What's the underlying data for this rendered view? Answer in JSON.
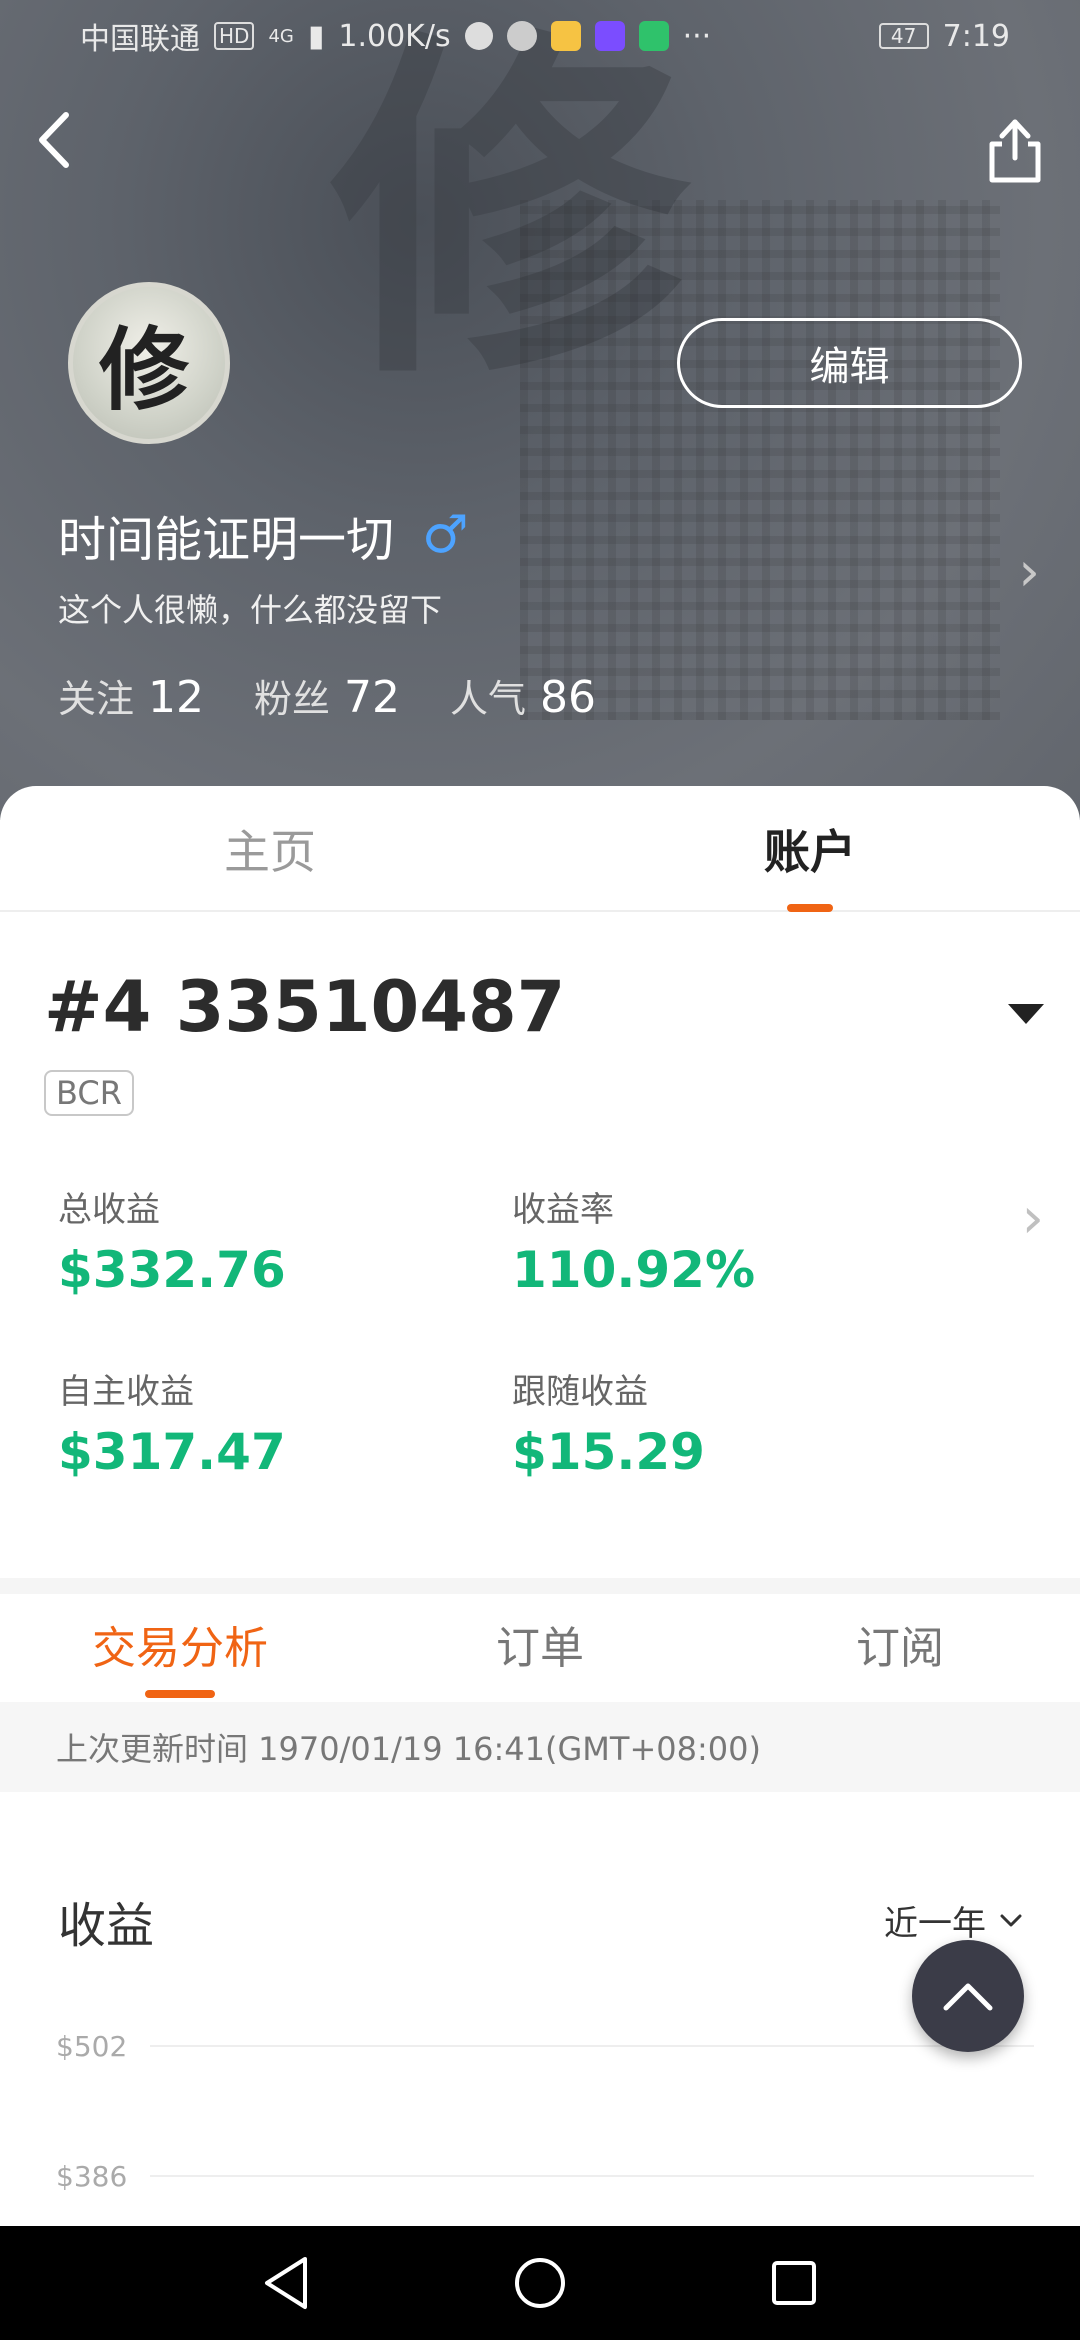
{
  "status_bar": {
    "carrier": "中国联通",
    "hd_badge": "HD",
    "network": "4G",
    "speed": "1.00K/s",
    "more": "···",
    "battery": "47",
    "time": "7:19"
  },
  "colors": {
    "accent": "#f06414",
    "gain": "#12b779",
    "gender": "#4da3ff"
  },
  "profile": {
    "avatar_glyph": "修",
    "edit_label": "编辑",
    "name": "时间能证明一切",
    "gender_symbol": "♂",
    "bio": "这个人很懒，什么都没留下",
    "stats": [
      {
        "label": "关注",
        "value": "12"
      },
      {
        "label": "粉丝",
        "value": "72"
      },
      {
        "label": "人气",
        "value": "86"
      }
    ]
  },
  "top_tabs": [
    {
      "label": "主页",
      "active": false
    },
    {
      "label": "账户",
      "active": true
    }
  ],
  "account": {
    "id": "#4 33510487",
    "tag": "BCR",
    "metrics": [
      {
        "label": "总收益",
        "value": "$332.76"
      },
      {
        "label": "收益率",
        "value": "110.92%"
      },
      {
        "label": "自主收益",
        "value": "$317.47"
      },
      {
        "label": "跟随收益",
        "value": "$15.29"
      }
    ]
  },
  "sub_tabs": [
    {
      "label": "交易分析",
      "active": true
    },
    {
      "label": "订单",
      "active": false
    },
    {
      "label": "订阅",
      "active": false
    }
  ],
  "last_update": "上次更新时间 1970/01/19 16:41(GMT+08:00)",
  "earnings": {
    "title": "收益",
    "period": "近一年"
  },
  "chart_data": {
    "type": "line",
    "title": "收益",
    "y_tick_labels": [
      "$502",
      "$386"
    ],
    "y_ticks": [
      502,
      386
    ],
    "series": []
  },
  "icons": {
    "back": "back-arrow-icon",
    "share": "share-icon",
    "scroll_top": "chevron-up-icon",
    "nav": [
      "back-triangle-icon",
      "home-circle-icon",
      "recents-square-icon"
    ]
  }
}
